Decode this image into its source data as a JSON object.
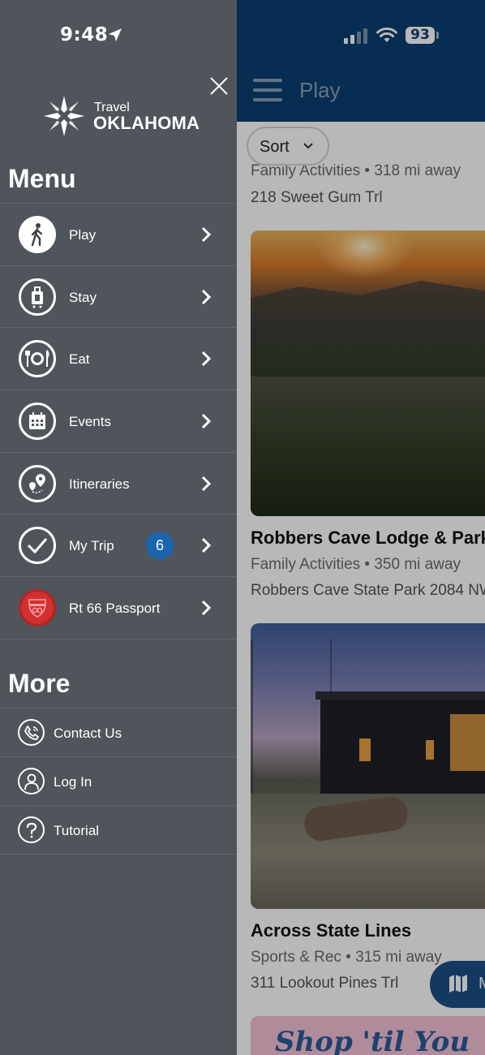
{
  "status_bar": {
    "time": "9:48",
    "battery": "93"
  },
  "header": {
    "title": "Play"
  },
  "sort": {
    "label": "Sort"
  },
  "listings": [
    {
      "meta": "Family Activities  •  318 mi away",
      "address": "218 Sweet Gum Trl"
    },
    {
      "title": "Robbers Cave Lodge & Park",
      "meta": "Family Activities  •  350 mi away",
      "address": "Robbers Cave State Park 2084 NW"
    },
    {
      "title": "Across State Lines",
      "meta": "Sports & Rec  •  315 mi away",
      "address": "311 Lookout Pines Trl"
    },
    {
      "image_text": "Shop 'til You"
    }
  ],
  "map_button": {
    "label": "M"
  },
  "drawer": {
    "logo": {
      "travel": "Travel",
      "name": "OKLAHOMA"
    },
    "menu_title": "Menu",
    "menu_items": [
      {
        "label": "Play",
        "icon": "walking-person-icon"
      },
      {
        "label": "Stay",
        "icon": "luggage-icon"
      },
      {
        "label": "Eat",
        "icon": "plate-utensils-icon"
      },
      {
        "label": "Events",
        "icon": "calendar-icon"
      },
      {
        "label": "Itineraries",
        "icon": "route-pins-icon"
      },
      {
        "label": "My Trip",
        "icon": "checkmark-icon",
        "badge": "6"
      },
      {
        "label": "Rt 66 Passport",
        "icon": "route-66-shield-icon"
      }
    ],
    "more_title": "More",
    "more_items": [
      {
        "label": "Contact Us",
        "icon": "phone-icon"
      },
      {
        "label": "Log In",
        "icon": "user-icon"
      },
      {
        "label": "Tutorial",
        "icon": "question-icon"
      }
    ]
  },
  "colors": {
    "drawer_bg": "#4f555b",
    "header_bg": "#0b3f73",
    "badge_bg": "#1a64ae",
    "passport_red": "#d22f2f"
  }
}
